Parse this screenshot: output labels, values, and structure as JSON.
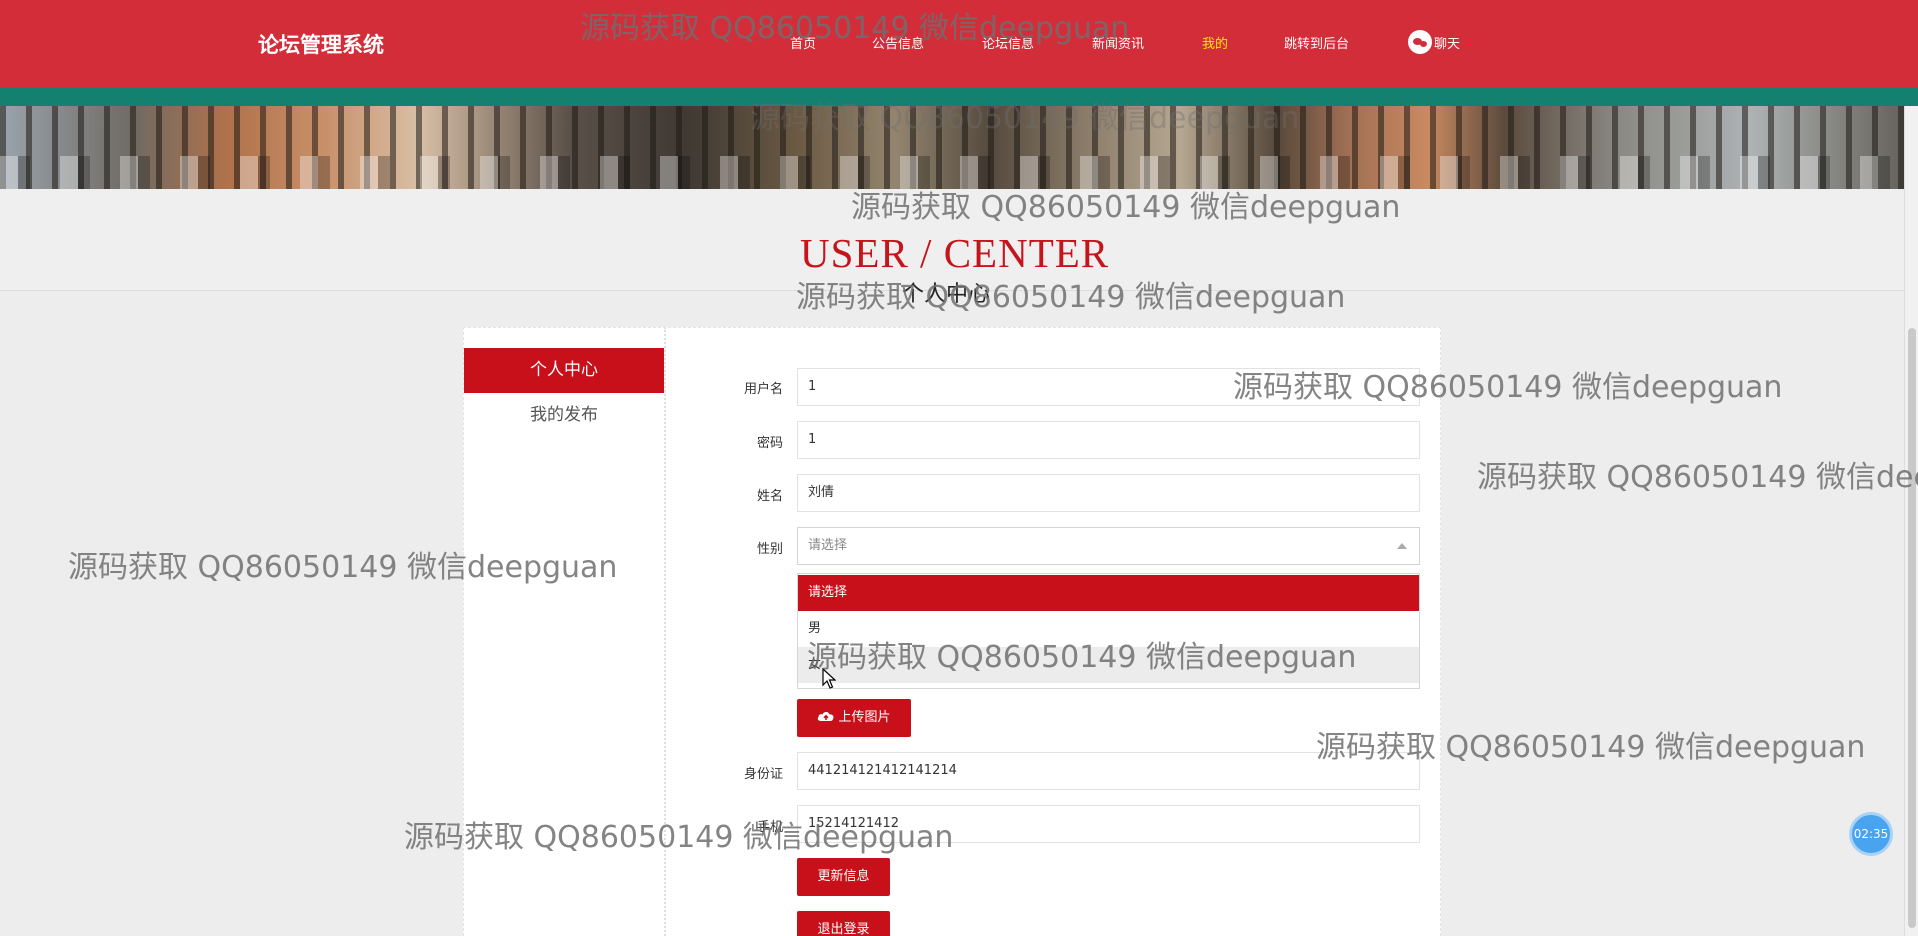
{
  "header": {
    "logo": "论坛管理系统",
    "nav": [
      {
        "label": "首页"
      },
      {
        "label": "公告信息"
      },
      {
        "label": "论坛信息"
      },
      {
        "label": "新闻资讯"
      },
      {
        "label": "我的",
        "active": true
      },
      {
        "label": "跳转到后台"
      }
    ],
    "chat_label": "聊天",
    "chat_icon": "wechat-chat-icon"
  },
  "title": {
    "en": "USER / CENTER",
    "cn": "个人中心"
  },
  "sidebar": {
    "items": [
      {
        "label": "个人中心",
        "active": true
      },
      {
        "label": "我的发布",
        "active": false
      }
    ]
  },
  "form": {
    "username_label": "用户名",
    "username_value": "1",
    "password_label": "密码",
    "password_value": "1",
    "name_label": "姓名",
    "name_value": "刘倩",
    "gender_label": "性别",
    "gender_placeholder": "请选择",
    "gender_options": [
      "请选择",
      "男",
      "女"
    ],
    "upload_label": "上传图片",
    "upload_icon": "cloud-upload-icon",
    "idcard_label": "身份证",
    "idcard_value": "441214121412141214",
    "phone_label": "手机",
    "phone_value": "15214121412",
    "update_button": "更新信息",
    "logout_button": "退出登录"
  },
  "timer": "02:35",
  "watermark": "源码获取 QQ86050149 微信deepguan",
  "colors": {
    "header_red": "#d42d3a",
    "accent_red": "#c8101b",
    "teal_stripe": "#14806f",
    "active_nav": "#ffe600",
    "timer_blue": "#4aa3ef"
  }
}
